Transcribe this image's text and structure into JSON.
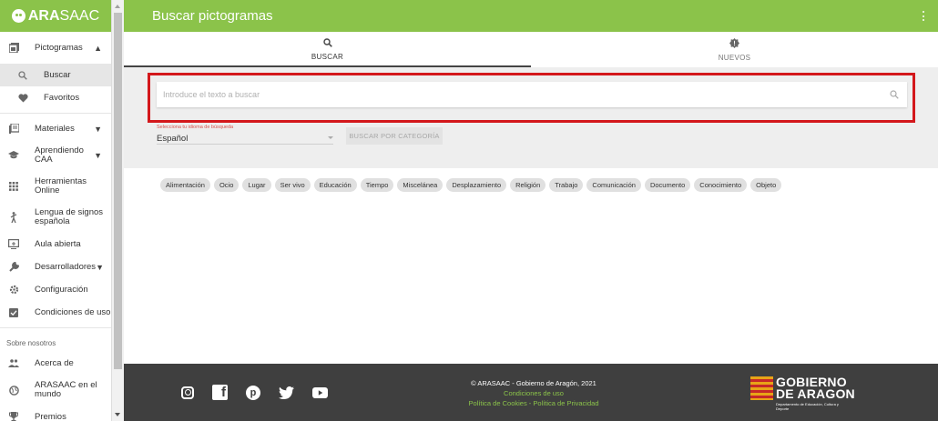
{
  "app": {
    "logo_bold": "ARA",
    "logo_rest": "SAAC"
  },
  "sidebar": {
    "items": [
      {
        "label": "Pictogramas",
        "icon": "pictograms-icon",
        "chevron": "up"
      },
      {
        "label": "Buscar",
        "icon": "search-icon",
        "sub": true,
        "active": true
      },
      {
        "label": "Favoritos",
        "icon": "heart-icon",
        "sub": true
      },
      {
        "label": "Materiales",
        "icon": "materials-icon",
        "chevron": "down"
      },
      {
        "label": "Aprendiendo CAA",
        "icon": "graduation-cap-icon",
        "chevron": "down"
      },
      {
        "label": "Herramientas Online",
        "icon": "apps-grid-icon"
      },
      {
        "label": "Lengua de signos española",
        "icon": "sign-language-icon"
      },
      {
        "label": "Aula abierta",
        "icon": "open-classroom-icon"
      },
      {
        "label": "Desarrolladores",
        "icon": "wrench-icon",
        "chevron": "down"
      },
      {
        "label": "Configuración",
        "icon": "gear-icon"
      },
      {
        "label": "Condiciones de uso",
        "icon": "checkbox-icon"
      }
    ],
    "section_label": "Sobre nosotros",
    "about_items": [
      {
        "label": "Acerca de",
        "icon": "people-icon"
      },
      {
        "label": "ARASAAC en el mundo",
        "icon": "globe-icon"
      },
      {
        "label": "Premios",
        "icon": "trophy-icon"
      }
    ]
  },
  "header": {
    "title": "Buscar pictogramas"
  },
  "tabs": [
    {
      "label": "BUSCAR",
      "icon": "search-icon",
      "active": true
    },
    {
      "label": "NUEVOS",
      "icon": "new-badge-icon",
      "active": false
    }
  ],
  "search": {
    "placeholder": "Introduce el texto a buscar",
    "value": ""
  },
  "language": {
    "floating_label": "Selecciona tu idioma de búsqueda",
    "value": "Español"
  },
  "category_button": "BUSCAR POR CATEGORÍA",
  "chips": [
    "Alimentación",
    "Ocio",
    "Lugar",
    "Ser vivo",
    "Educación",
    "Tiempo",
    "Miscelánea",
    "Desplazamiento",
    "Religión",
    "Trabajo",
    "Comunicación",
    "Documento",
    "Conocimiento",
    "Objeto"
  ],
  "footer": {
    "copyright": "© ARASAAC - Gobierno de Aragón, 2021",
    "conditions": "Condiciones de uso",
    "policies": "Política de Cookies - Política de Privacidad",
    "gov_line1": "GOBIERNO",
    "gov_line2": "DE ARAGON",
    "gov_dept": "Departamento de Educación, Cultura y Deporte"
  },
  "colors": {
    "brand_green": "#8bc34a",
    "highlight_red": "#d3171b",
    "footer_bg": "#3f3f3f"
  }
}
